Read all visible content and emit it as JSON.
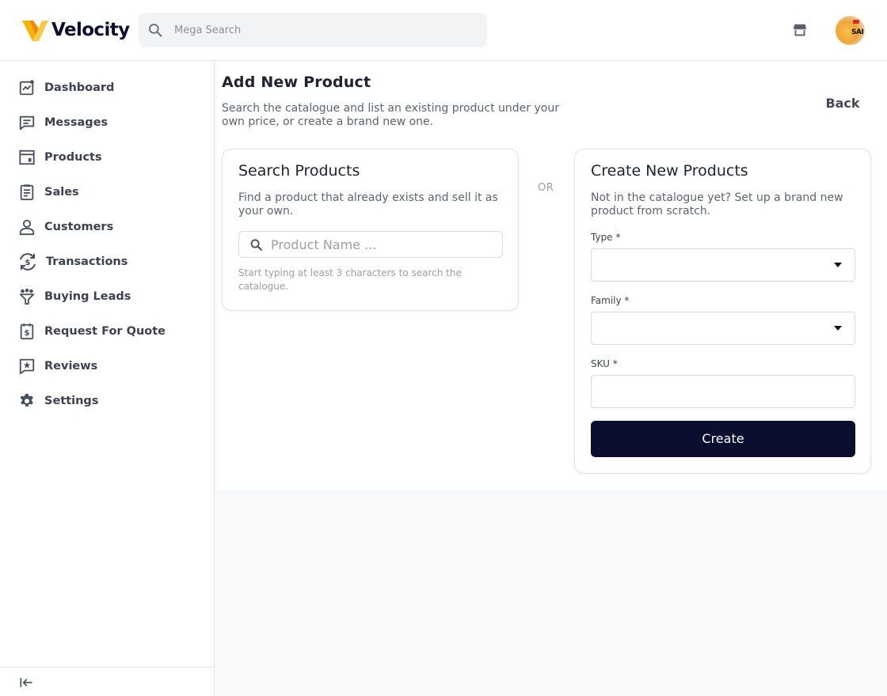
{
  "header": {
    "brand_name": "Velocity",
    "search_placeholder": "Mega Search",
    "avatar_text": "SAI"
  },
  "sidebar": {
    "items": [
      {
        "label": "Dashboard",
        "icon": "dashboard-icon"
      },
      {
        "label": "Messages",
        "icon": "messages-icon"
      },
      {
        "label": "Products",
        "icon": "products-icon"
      },
      {
        "label": "Sales",
        "icon": "sales-icon"
      },
      {
        "label": "Customers",
        "icon": "customers-icon"
      },
      {
        "label": "Transactions",
        "icon": "transactions-icon"
      },
      {
        "label": "Buying Leads",
        "icon": "buying-leads-icon"
      },
      {
        "label": "Request For Quote",
        "icon": "request-for-quote-icon"
      },
      {
        "label": "Reviews",
        "icon": "reviews-icon"
      },
      {
        "label": "Settings",
        "icon": "settings-icon"
      }
    ]
  },
  "main": {
    "title": "Add New Product",
    "subtitle": "Search the catalogue and list an existing product under your own price, or create a brand new one.",
    "back_label": "Back",
    "or_label": "OR",
    "search_card": {
      "title": "Search Products",
      "description": "Find a product that already exists and sell it as your own.",
      "input_placeholder": "Product Name ...",
      "hint": "Start typing at least 3 characters to search the catalogue."
    },
    "create_card": {
      "title": "Create New Products",
      "description": "Not in the catalogue yet? Set up a brand new product from scratch.",
      "type_label": "Type *",
      "type_value": "",
      "family_label": "Family *",
      "family_value": "",
      "sku_label": "SKU *",
      "sku_value": "",
      "create_label": "Create"
    }
  },
  "colors": {
    "brand_navy": "#0b0e2e",
    "brand_yellow": "#f5b400",
    "brand_orange": "#f08a00"
  }
}
